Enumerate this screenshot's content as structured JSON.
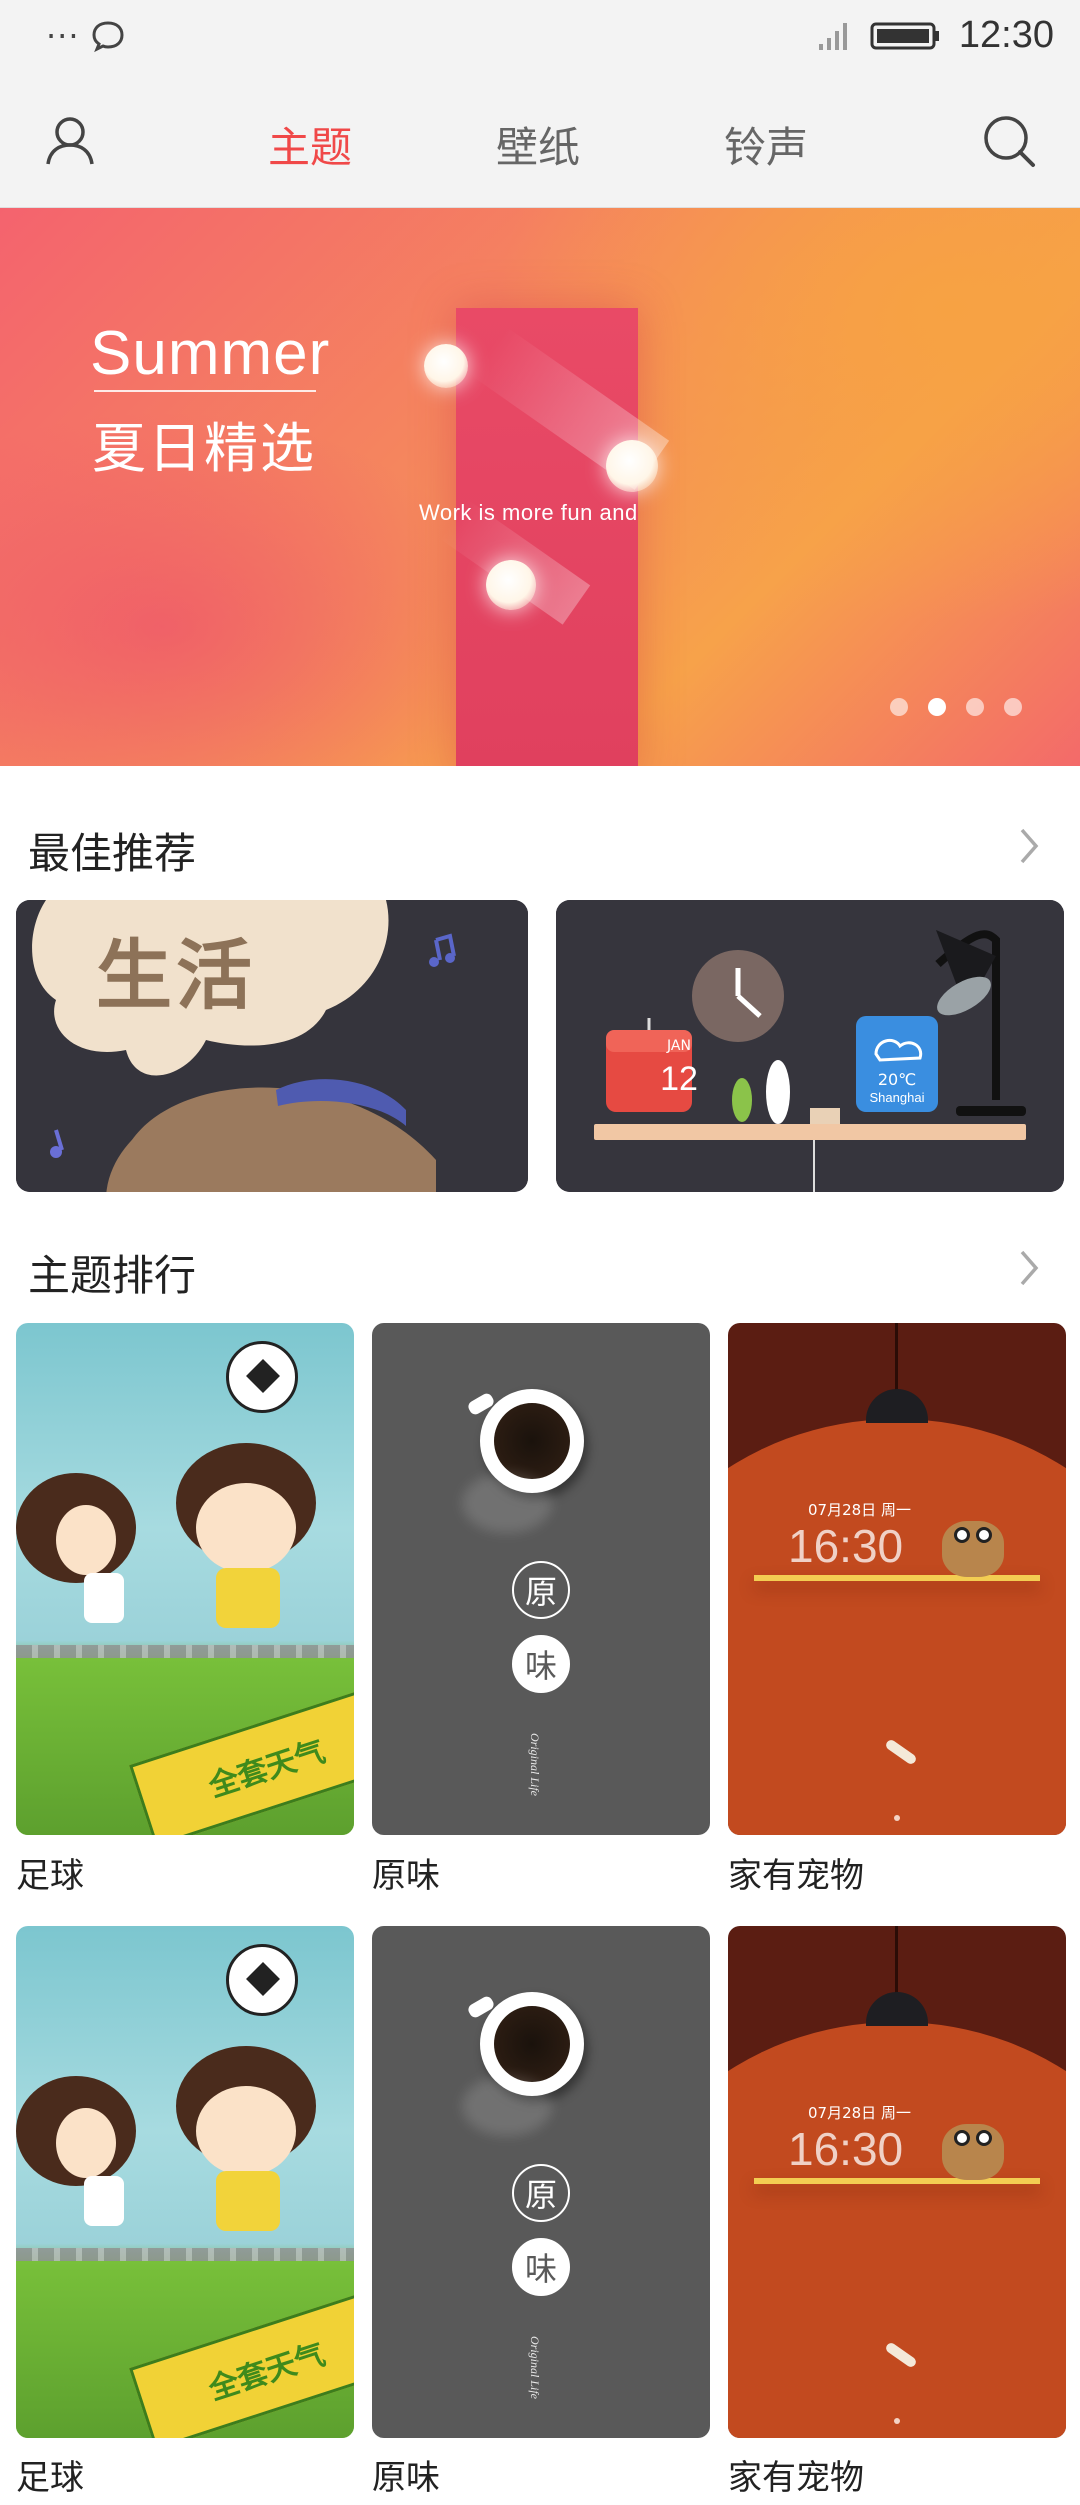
{
  "status_bar": {
    "time": "12:30"
  },
  "nav": {
    "tabs": [
      {
        "label": "主题",
        "active": true
      },
      {
        "label": "壁纸",
        "active": false
      },
      {
        "label": "铃声",
        "active": false
      }
    ]
  },
  "banner": {
    "title_en": "Summer",
    "title_cn": "夏日精选",
    "caption": "Work is more fun and",
    "dot_count": 4,
    "active_dot": 1
  },
  "recommend": {
    "title": "最佳推荐",
    "card1_text": "生活"
  },
  "rec_widget": {
    "month": "JAN",
    "day": "12",
    "temp": "20℃",
    "city": "Shanghai"
  },
  "ranking": {
    "title": "主题排行",
    "rows": [
      {
        "items": [
          {
            "name": "足球"
          },
          {
            "name": "原味"
          },
          {
            "name": "家有宠物"
          }
        ]
      },
      {
        "items": [
          {
            "name": "足球"
          },
          {
            "name": "原味"
          },
          {
            "name": "家有宠物"
          }
        ]
      }
    ]
  },
  "thumb_text": {
    "football_banner": "全套天气",
    "coffee_char1": "原",
    "coffee_char2": "味",
    "coffee_sub": "Original Life",
    "pet_date": "07月28日 周一",
    "pet_time": "16:30"
  },
  "colors": {
    "accent": "#f04848",
    "banner_bar": "#e94a66"
  }
}
